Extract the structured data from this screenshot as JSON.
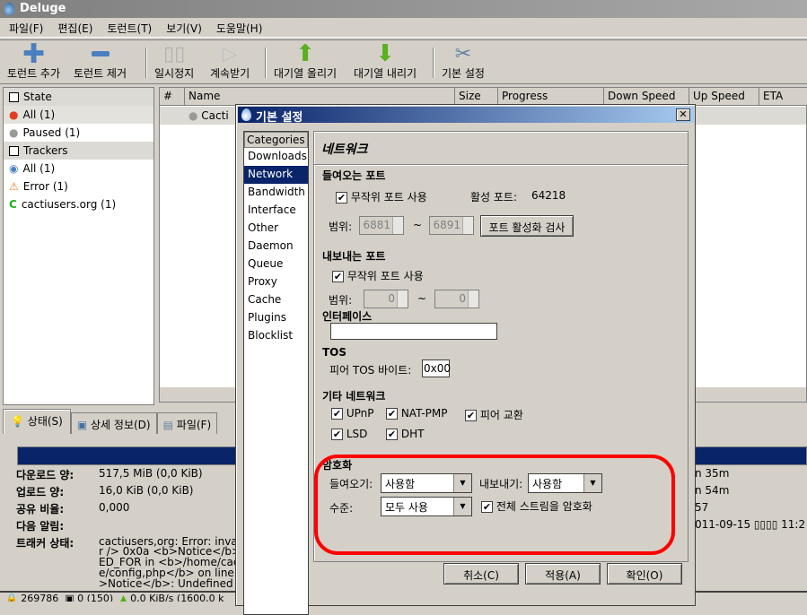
{
  "app": {
    "title": "Deluge"
  },
  "menu": [
    "파일(F)",
    "편집(E)",
    "토런트(T)",
    "보기(V)",
    "도움말(H)"
  ],
  "toolbar": {
    "add": "토런트 추가",
    "remove": "토런트 제거",
    "pause": "일시정지",
    "resume": "계속받기",
    "queue_up": "대기열 올리기",
    "queue_down": "대기열 내리기",
    "prefs": "기본 설정"
  },
  "sidebar": {
    "state": "State",
    "state_items": [
      "All (1)",
      "Paused (1)"
    ],
    "trackers": "Trackers",
    "tracker_items": [
      "All (1)",
      "Error (1)",
      "cactiusers.org (1)"
    ]
  },
  "list": {
    "columns": [
      "#",
      "Name",
      "Size",
      "Progress",
      "Down Speed",
      "Up Speed",
      "ETA"
    ],
    "row_name": "Cacti"
  },
  "tabs": [
    "상태(S)",
    "상세 정보(D)",
    "파일(F)"
  ],
  "details": {
    "progress_percent": 100,
    "rows": [
      {
        "label": "다운로드 양:",
        "value": "517,5 MiB (0,0 KiB)"
      },
      {
        "label": "업로드 양:",
        "value": "16,0 KiB (0,0 KiB)"
      },
      {
        "label": "공유 비율:",
        "value": "0,000"
      },
      {
        "label": "다음 알림:",
        "value": ""
      },
      {
        "label": "트래커 상태:",
        "value": "cactiusers,org: Error: inval"
      }
    ],
    "tracker_lines": [
      "r /> 0x0a <b>Notice</b>:",
      "ED_FOR in <b>/home/cac",
      "e/config,php</b> on line",
      ">Notice</b>:  Undefined i"
    ],
    "right_values": [
      "n 35m",
      "n 54m",
      "57",
      "011-09-15 ▯▯▯▯ 11:2"
    ]
  },
  "statusbar": {
    "connections": "269786",
    "dht": "0 (150)",
    "down": "0,0 KiB/s (1600,0 k"
  },
  "dialog": {
    "title": "기본 설정",
    "close": "✕",
    "categories_header": "Categories",
    "categories": [
      "Downloads",
      "Network",
      "Bandwidth",
      "Interface",
      "Other",
      "Daemon",
      "Queue",
      "Proxy",
      "Cache",
      "Plugins",
      "Blocklist"
    ],
    "selected_category": "Network",
    "page_title": "네트워크",
    "incoming": {
      "title": "들여오는 포트",
      "random": "무작위 포트 사용",
      "active_label": "활성 포트:",
      "active_port": "64218",
      "range_label": "범위:",
      "from": "6881",
      "to": "6891",
      "tilde": "~",
      "test": "포트 활성화 검사"
    },
    "outgoing": {
      "title": "내보내는 포트",
      "random": "무작위 포트 사용",
      "range_label": "범위:",
      "from": "0",
      "to": "0",
      "tilde": "~"
    },
    "interface": {
      "title": "인터페이스",
      "value": ""
    },
    "tos": {
      "title": "TOS",
      "label": "피어 TOS 바이트:",
      "value": "0x00"
    },
    "misc": {
      "title": "기타 네트워크",
      "items": [
        "UPnP",
        "NAT-PMP",
        "피어 교환",
        "LSD",
        "DHT"
      ]
    },
    "encryption": {
      "title": "암호화",
      "inbound_label": "들여오기:",
      "inbound": "사용함",
      "outbound_label": "내보내기:",
      "outbound": "사용함",
      "level_label": "수준:",
      "level": "모두 사용",
      "encrypt_all": "전체 스트림을 암호화"
    },
    "buttons": {
      "cancel": "취소(C)",
      "apply": "적용(A)",
      "ok": "확인(O)"
    },
    "highlight_color": "#ff0000"
  }
}
